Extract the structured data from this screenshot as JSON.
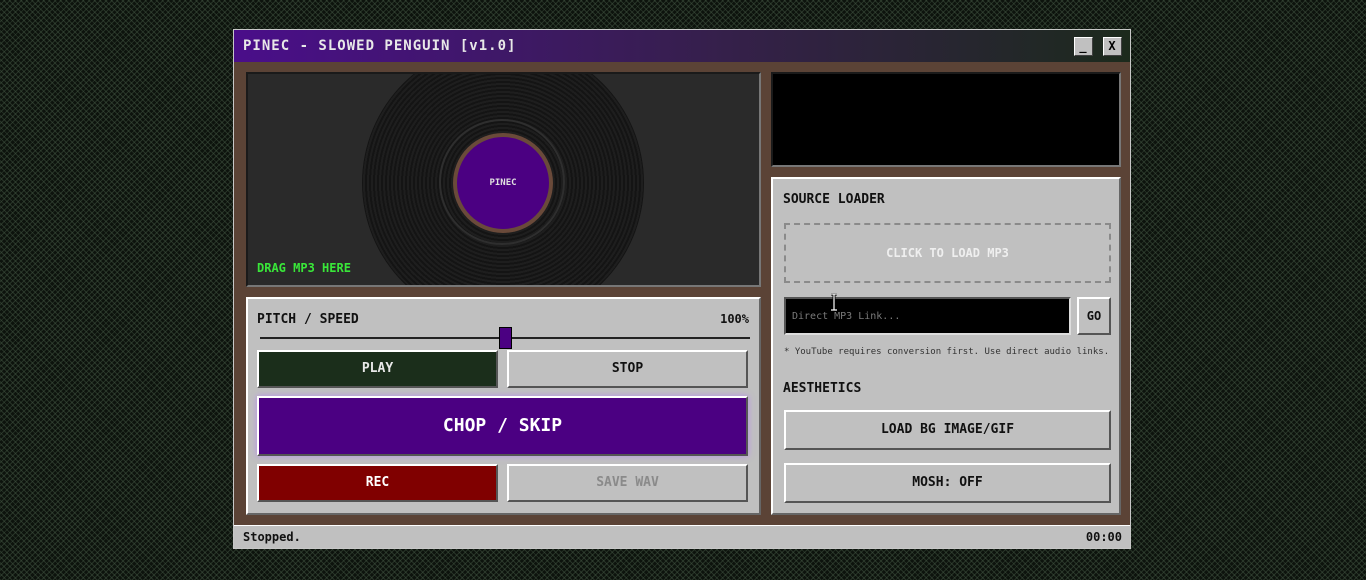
{
  "window": {
    "title": "PINEC - SLOWED PENGUIN [v1.0]",
    "minimize_label": "_",
    "close_label": "X"
  },
  "player": {
    "record_label": "PINEC",
    "drag_hint": "DRAG MP3 HERE"
  },
  "controls": {
    "pitch_label": "PITCH / SPEED",
    "pitch_value": "100%",
    "pitch_level_fraction": 0.5,
    "play_label": "PLAY",
    "stop_label": "STOP",
    "chop_label": "CHOP / SKIP",
    "rec_label": "REC",
    "save_label": "SAVE WAV"
  },
  "source_loader": {
    "title": "SOURCE LOADER",
    "drop_label": "CLICK TO LOAD MP3",
    "url_placeholder": "Direct MP3 Link...",
    "url_value": "",
    "go_label": "GO",
    "note": "* YouTube requires conversion first. Use direct audio links."
  },
  "aesthetics": {
    "title": "AESTHETICS",
    "load_bg_label": "LOAD BG IMAGE/GIF",
    "mosh_label": "MOSH: OFF"
  },
  "status": {
    "text": "Stopped.",
    "time": "00:00"
  },
  "colors": {
    "accent": "#4b0082",
    "drag_hint": "#39e639",
    "record_button": "#800000",
    "play_button": "#1b2e1b",
    "frame": "#5b4336"
  }
}
